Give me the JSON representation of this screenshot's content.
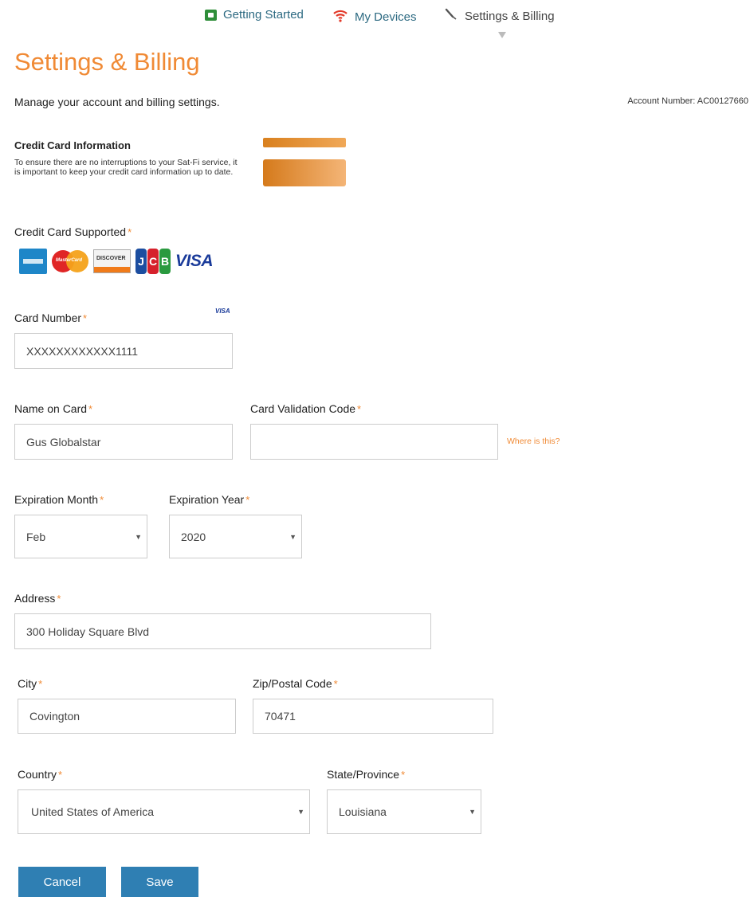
{
  "nav": {
    "getting_started": "Getting Started",
    "my_devices": "My Devices",
    "settings_billing": "Settings & Billing"
  },
  "page": {
    "title": "Settings & Billing",
    "subtitle": "Manage your account and billing settings.",
    "account_number": "Account Number: AC00127660"
  },
  "credit_card": {
    "heading": "Credit Card Information",
    "description": "To ensure there are no interruptions to your Sat-Fi service, it is important to keep your credit card information up to date."
  },
  "supported": {
    "label": "Credit Card Supported",
    "logos": [
      "amex-logo",
      "mastercard-logo",
      "discover-logo",
      "jcb-logo",
      "visa-logo"
    ],
    "mastercard_text": "MasterCard",
    "discover_text": "DISCOVER",
    "jcb_text": [
      "J",
      "C",
      "B"
    ],
    "visa_text": "VISA"
  },
  "card_number": {
    "label": "Card Number",
    "value": "XXXXXXXXXXXX1111",
    "detected_brand": "VISA"
  },
  "name_on_card": {
    "label": "Name on Card",
    "value": "Gus Globalstar"
  },
  "cvc": {
    "label": "Card Validation Code",
    "value": "",
    "help_link": "Where is this?"
  },
  "exp_month": {
    "label": "Expiration Month",
    "value": "Feb"
  },
  "exp_year": {
    "label": "Expiration Year",
    "value": "2020"
  },
  "address": {
    "label": "Address",
    "value": "300 Holiday Square Blvd"
  },
  "city": {
    "label": "City",
    "value": "Covington"
  },
  "zip": {
    "label": "Zip/Postal Code",
    "value": "70471"
  },
  "country": {
    "label": "Country",
    "value": "United States of America"
  },
  "state": {
    "label": "State/Province",
    "value": "Louisiana"
  },
  "required_marker": "*",
  "buttons": {
    "cancel": "Cancel",
    "save": "Save"
  },
  "colors": {
    "accent": "#f08a35",
    "button": "#2f7fb3",
    "nav_link": "#2d6a82"
  }
}
